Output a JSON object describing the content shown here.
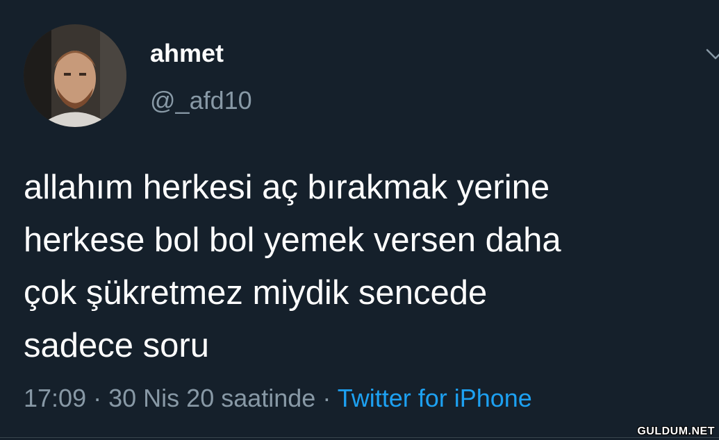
{
  "tweet": {
    "display_name": "ahmet",
    "handle": "@_afd10",
    "text_lines": [
      "allahım herkesi aç bırakmak yerine",
      "herkese bol bol yemek versen daha",
      "çok şükretmez miydik sencede",
      "sadece soru"
    ],
    "time": "17:09",
    "separator": "·",
    "date": "30 Nis 20 saatinde",
    "source": "Twitter for iPhone"
  },
  "icons": {
    "avatar": "profile-photo",
    "menu": "chevron-down-icon"
  },
  "watermark": "GULDUM.NET",
  "colors": {
    "background": "#15202b",
    "primary_text": "#ffffff",
    "secondary_text": "#8899a6",
    "link": "#1da1f2"
  }
}
